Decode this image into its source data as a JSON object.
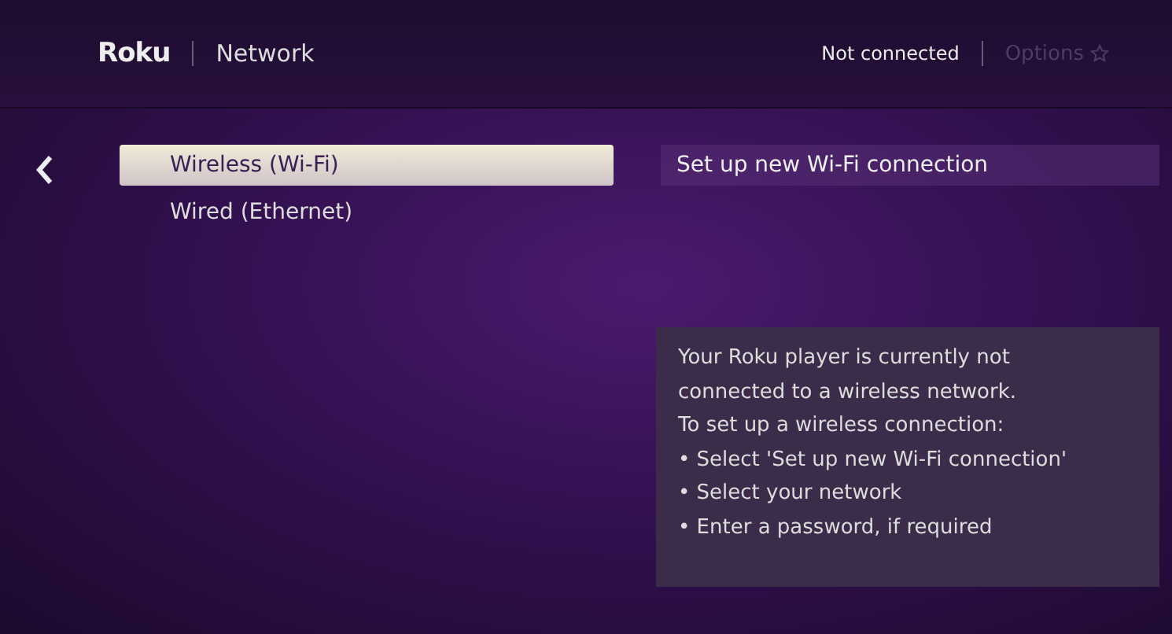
{
  "header": {
    "logo": "Roku",
    "title": "Network",
    "status": "Not connected",
    "options": {
      "label": "Options",
      "disabled": true
    }
  },
  "menu": [
    {
      "label": "Wireless (Wi-Fi)",
      "selected": true
    },
    {
      "label": "Wired (Ethernet)",
      "selected": false
    }
  ],
  "action": "Set up new Wi-Fi connection",
  "info": [
    "Your Roku player is currently not",
    "connected to a wireless network.",
    "To set up a wireless connection:",
    "• Select 'Set up new Wi-Fi connection'",
    "• Select your network",
    "• Enter a password, if required"
  ]
}
